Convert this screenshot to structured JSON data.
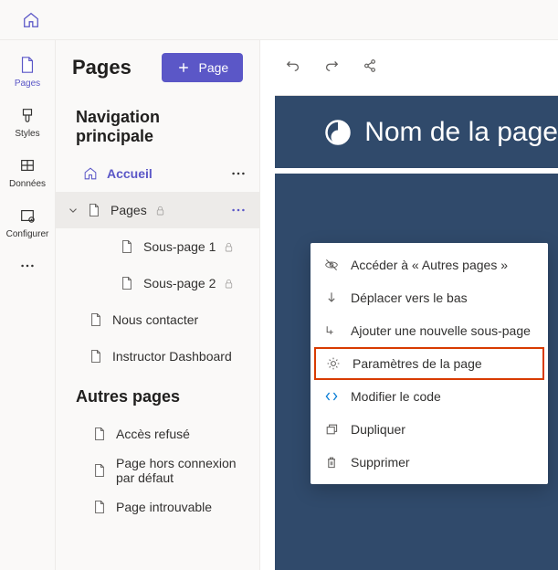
{
  "rail": {
    "items": [
      {
        "label": "Pages"
      },
      {
        "label": "Styles"
      },
      {
        "label": "Données"
      },
      {
        "label": "Configurer"
      }
    ]
  },
  "panel": {
    "title": "Pages",
    "new_page_label": "Page",
    "section_main": "Navigation principale",
    "section_other": "Autres pages",
    "tree": {
      "home": "Accueil",
      "pages": "Pages",
      "sub1": "Sous-page 1",
      "sub2": "Sous-page 2",
      "contact": "Nous contacter",
      "instructor": "Instructor Dashboard"
    },
    "other": {
      "denied": "Accès refusé",
      "offline": "Page hors connexion par défaut",
      "notfound": "Page introuvable"
    }
  },
  "canvas": {
    "banner_title": "Nom de la page"
  },
  "menu": {
    "other_pages": "Accéder à « Autres pages »",
    "move_down": "Déplacer vers le bas",
    "add_sub": "Ajouter une nouvelle sous-page",
    "settings": "Paramètres de la page",
    "edit_code": "Modifier le code",
    "duplicate": "Dupliquer",
    "delete": "Supprimer"
  }
}
